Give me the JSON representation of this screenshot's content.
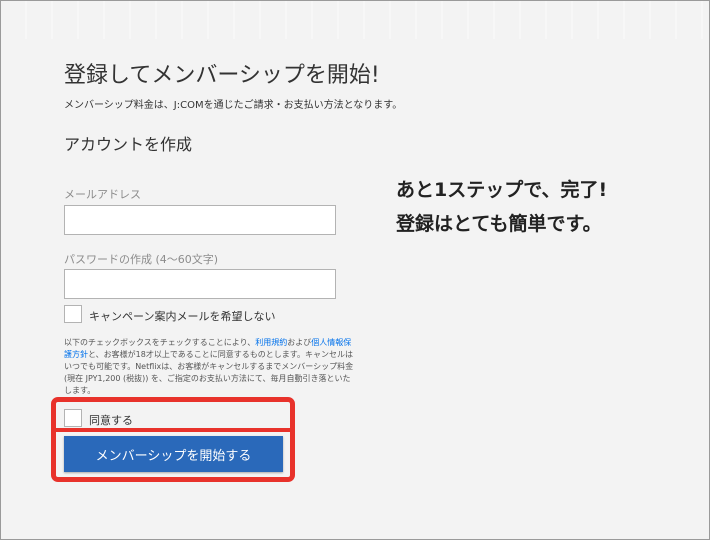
{
  "page": {
    "title": "登録してメンバーシップを開始!",
    "subtitle": "メンバーシップ料金は、J:COMを通じたご請求・お支払い方法となります。",
    "section_title": "アカウントを作成"
  },
  "form": {
    "email_label": "メールアドレス",
    "email_value": "",
    "password_label": "パスワードの作成 (4〜60文字)",
    "password_value": "",
    "campaign_optout_label": "キャンペーン案内メールを希望しない",
    "campaign_optout_checked": false,
    "legal_part1": "以下のチェックボックスをチェックすることにより、",
    "terms_link": "利用規約",
    "legal_part2": "および",
    "privacy_link": "個人情報保護方針",
    "legal_part3": "と、お客様が18才以上であることに同意するものとします。キャンセルはいつでも可能です。Netflixは、お客様がキャンセルするまでメンバーシップ料金 (現在 JPY1,200 (税抜)) を、ご指定のお支払い方法にて、毎月自動引き落といたします。",
    "agree_label": "同意する",
    "agree_checked": false,
    "submit_label": "メンバーシップを開始する"
  },
  "callout": {
    "line1": "あと1ステップで、完了!",
    "line2": "登録はとても簡単です。"
  },
  "colors": {
    "accent_blue": "#2a69ba",
    "highlight_red": "#e8322b",
    "link_blue": "#0071eb"
  }
}
